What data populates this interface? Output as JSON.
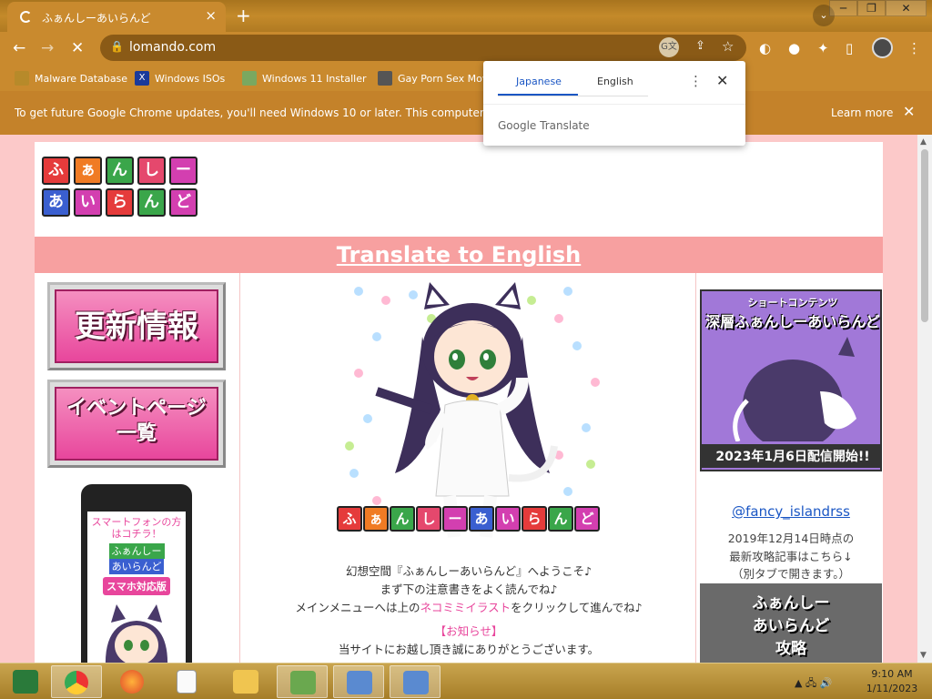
{
  "browser": {
    "tab_title": "ふぁんしーあいらんど",
    "tab_close": "×",
    "new_tab": "+",
    "tab_search": "⌄",
    "window_buttons": {
      "minimize": "─",
      "maximize": "❐",
      "close": "✕"
    },
    "url": "lomando.com",
    "nav": {
      "back": "←",
      "forward": "→",
      "reload": "✕"
    },
    "bookmarks": [
      {
        "label": "Malware Database",
        "icon": "folder-icon"
      },
      {
        "label": "Windows ISOs",
        "icon": "x-icon"
      },
      {
        "label": "Windows 11 Installer",
        "icon": "image-icon"
      },
      {
        "label": "Gay Porn Sex Mov",
        "icon": "globe-icon"
      }
    ],
    "infobar": {
      "message": "To get future Google Chrome updates, you'll need Windows 10 or later. This computer is usin",
      "learn_more": "Learn more",
      "close": "✕"
    }
  },
  "translate_popup": {
    "source_lang": "Japanese",
    "target_lang": "English",
    "menu": "⋮",
    "close": "✕",
    "google": "Google",
    "translate": " Translate"
  },
  "page": {
    "logo_tiles": [
      {
        "char": "ふ",
        "color": "#e53b3b"
      },
      {
        "char": "ぁ",
        "color": "#f07b24"
      },
      {
        "char": "ん",
        "color": "#3aa64a"
      },
      {
        "char": "し",
        "color": "#e5486d"
      },
      {
        "char": "ー",
        "color": "#d33fb0"
      },
      {
        "char": "あ",
        "color": "#3a5fd0"
      },
      {
        "char": "い",
        "color": "#d33fb0"
      },
      {
        "char": "ら",
        "color": "#e53b3b"
      },
      {
        "char": "ん",
        "color": "#3aa64a"
      },
      {
        "char": "ど",
        "color": "#d33fb0"
      }
    ],
    "banner_link": "Translate to English",
    "menu_buttons": [
      {
        "label": "更新情報"
      },
      {
        "label": "イベントページ一覧"
      }
    ],
    "phone": {
      "text1": "スマートフォンの方はコチラ！",
      "logo_top": "ふぁんしー",
      "logo_bottom": "あいらんど",
      "badge": "スマホ対応版"
    },
    "welcome": {
      "line1": "幻想空間『ふぁんしーあいらんど』へようこそ♪",
      "line2": "まず下の注意書きをよく読んでね♪",
      "line3_pre": "メインメニューへは上の",
      "line3_link": "ネコミミイラスト",
      "line3_post": "をクリックして進んでね♪",
      "notice_open": "【",
      "notice_link": "お知らせ",
      "notice_close": "】",
      "line5": "当サイトにお越し頂き誠にありがとうございます。"
    },
    "chara_logo": "ふぁんしーあいらんど",
    "right": {
      "promo_top": "ショートコンテンツ",
      "promo_title": "深層ふぁんしーあいらんど",
      "promo_date": "2023年1月6日配信開始!!",
      "twitter": "@fancy_islandrss",
      "note1": "2019年12月14日時点の",
      "note2": "最新攻略記事はこちら↓",
      "note3": "（別タブで開きます。）",
      "guide1": "ふぁんしー",
      "guide2": "あいらんど",
      "guide3": "攻略"
    }
  },
  "taskbar": {
    "items": [
      {
        "name": "system-icon",
        "active": false
      },
      {
        "name": "chrome-icon",
        "active": true
      },
      {
        "name": "firefox-icon",
        "active": false
      },
      {
        "name": "file-icon",
        "active": false
      },
      {
        "name": "folder-icon",
        "active": false
      },
      {
        "name": "users-icon",
        "active": false
      },
      {
        "name": "network-icon",
        "active": false
      },
      {
        "name": "network-icon-2",
        "active": false
      }
    ],
    "time": "9:10 AM",
    "date": "1/11/2023"
  }
}
